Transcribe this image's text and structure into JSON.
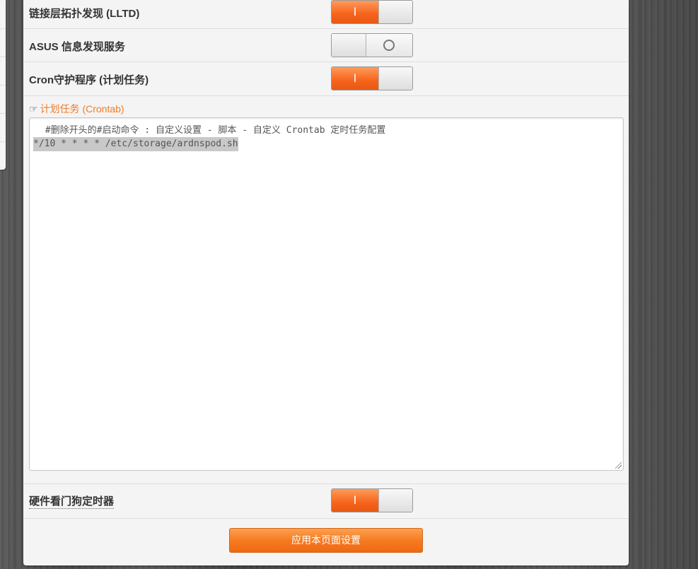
{
  "settings": {
    "lltd": {
      "label": "链接层拓扑发现 (LLTD)",
      "state": "on",
      "on_glyph": "I"
    },
    "asus_discovery": {
      "label": "ASUS 信息发现服务",
      "state": "off"
    },
    "cron": {
      "label": "Cron守护程序 (计划任务)",
      "state": "on",
      "on_glyph": "I"
    },
    "watchdog": {
      "label": "硬件看门狗定时器",
      "state": "on",
      "on_glyph": "I"
    }
  },
  "crontab": {
    "title": "计划任务 (Crontab)",
    "icon": "pointing-hand-icon",
    "comment_line": " #删除开头的#启动命令 : 自定义设置 - 脚本 - 自定义 Crontab 定时任务配置",
    "selected_line": "*/10 * * * * /etc/storage/ardnspod.sh"
  },
  "apply_button": {
    "label": "应用本页面设置"
  },
  "colors": {
    "accent": "#f7631c",
    "title": "#f07a2a",
    "panel": "#f4f4f4"
  }
}
